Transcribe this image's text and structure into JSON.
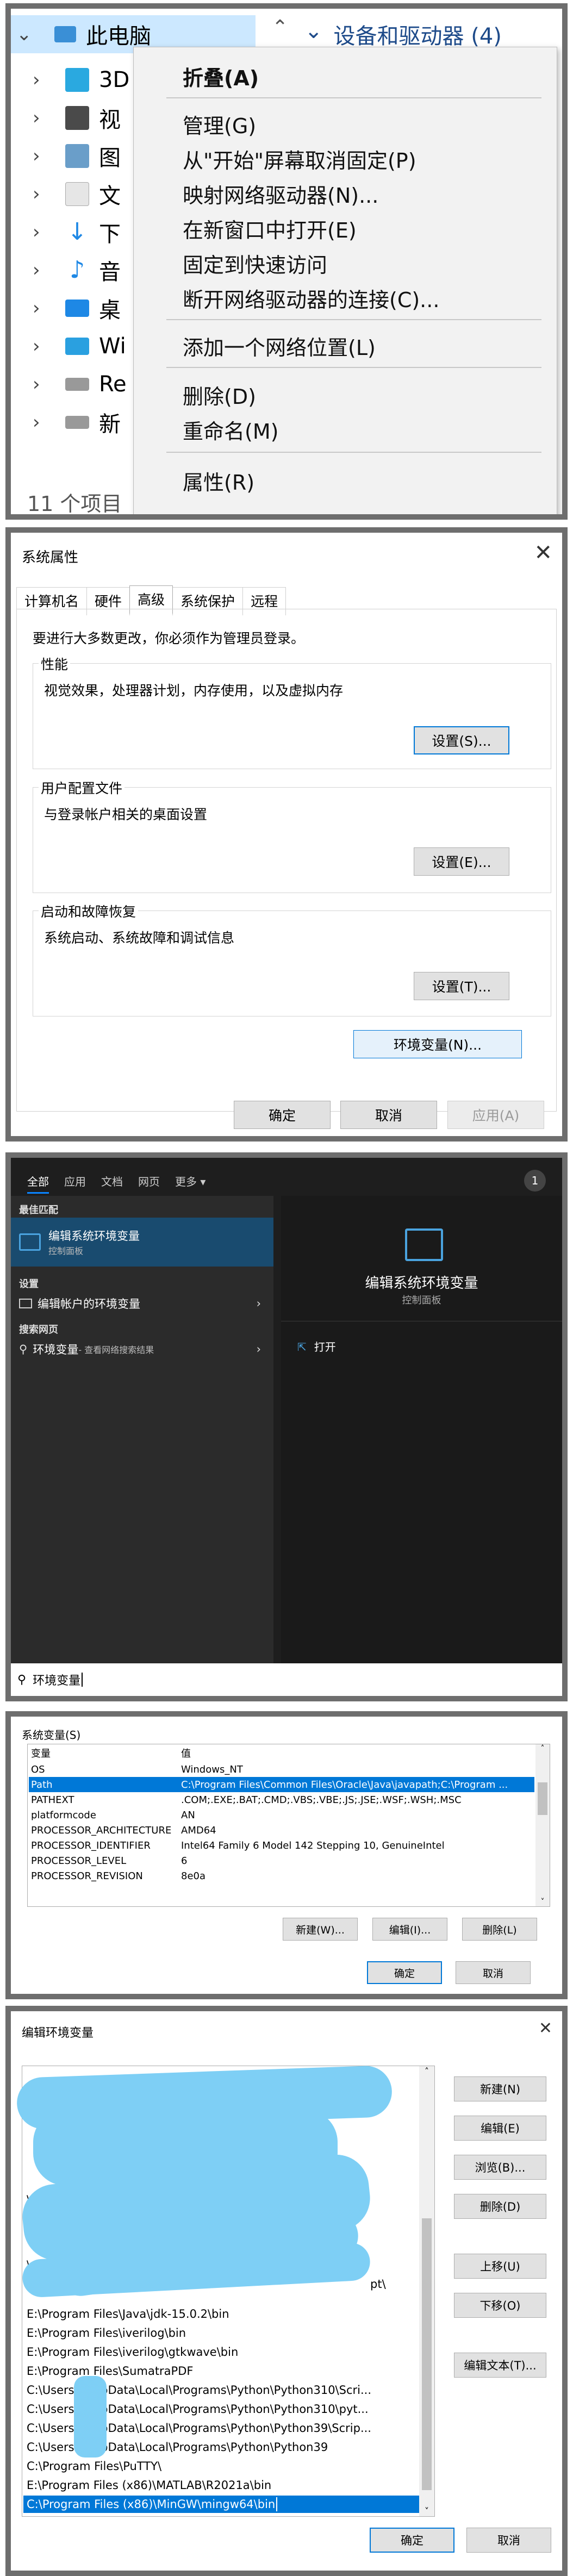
{
  "explorer": {
    "tree": [
      {
        "label": "此电脑",
        "expanded": true,
        "color": "#3a8fd6"
      },
      {
        "label": "3D",
        "color": "#2aa9e0"
      },
      {
        "label": "视",
        "color": "#4a4a4a"
      },
      {
        "label": "图",
        "color": "#6a9ec9"
      },
      {
        "label": "文",
        "color": "#cfcfcf"
      },
      {
        "label": "下",
        "color": "#1e88e5"
      },
      {
        "label": "音",
        "color": "#1e88e5"
      },
      {
        "label": "桌",
        "color": "#1e88e5"
      },
      {
        "label": "Wi",
        "color": "#2aa0e0"
      },
      {
        "label": "Re",
        "color": "#888888"
      },
      {
        "label": "新",
        "color": "#888888"
      }
    ],
    "footer": "11 个项目",
    "right_header": "设备和驱动器 (4)"
  },
  "context_menu": {
    "items": [
      "折叠(A)",
      "管理(G)",
      "从\"开始\"屏幕取消固定(P)",
      "映射网络驱动器(N)...",
      "在新窗口中打开(E)",
      "固定到快速访问",
      "断开网络驱动器的连接(C)...",
      "添加一个网络位置(L)",
      "删除(D)",
      "重命名(M)",
      "属性(R)"
    ]
  },
  "sys_props": {
    "title": "系统属性",
    "close": "✕",
    "tabs": [
      "计算机名",
      "硬件",
      "高级",
      "系统保护",
      "远程"
    ],
    "admin_note": "要进行大多数更改，你必须作为管理员登录。",
    "groups": [
      {
        "label": "性能",
        "desc": "视觉效果，处理器计划，内存使用，以及虚拟内存",
        "button": "设置(S)..."
      },
      {
        "label": "用户配置文件",
        "desc": "与登录帐户相关的桌面设置",
        "button": "设置(E)..."
      },
      {
        "label": "启动和故障恢复",
        "desc": "系统启动、系统故障和调试信息",
        "button": "设置(T)..."
      }
    ],
    "env_button": "环境变量(N)...",
    "ok": "确定",
    "cancel": "取消",
    "apply": "应用(A)"
  },
  "search": {
    "tabs": [
      "全部",
      "应用",
      "文档",
      "网页",
      "更多 ▾"
    ],
    "badge": "1",
    "best_match_heading": "最佳匹配",
    "best_title": "编辑系统环境变量",
    "best_sub": "控制面板",
    "settings_heading": "设置",
    "settings_item": "编辑帐户的环境变量",
    "web_heading": "搜索网页",
    "web_item": "环境变量",
    "web_item_sub": " - 查看网络搜索结果",
    "preview_title": "编辑系统环境变量",
    "preview_type": "控制面板",
    "open": "打开",
    "query": "环境变量"
  },
  "sys_vars": {
    "title": "系统变量(S)",
    "col_var": "变量",
    "col_val": "值",
    "rows": [
      {
        "k": "OS",
        "v": "Windows_NT"
      },
      {
        "k": "Path",
        "v": "C:\\Program Files\\Common Files\\Oracle\\Java\\javapath;C:\\Program ..."
      },
      {
        "k": "PATHEXT",
        "v": ".COM;.EXE;.BAT;.CMD;.VBS;.VBE;.JS;.JSE;.WSF;.WSH;.MSC"
      },
      {
        "k": "platformcode",
        "v": "AN"
      },
      {
        "k": "PROCESSOR_ARCHITECTURE",
        "v": "AMD64"
      },
      {
        "k": "PROCESSOR_IDENTIFIER",
        "v": "Intel64 Family 6 Model 142 Stepping 10, GenuineIntel"
      },
      {
        "k": "PROCESSOR_LEVEL",
        "v": "6"
      },
      {
        "k": "PROCESSOR_REVISION",
        "v": "8e0a"
      }
    ],
    "new": "新建(W)...",
    "edit": "编辑(I)...",
    "delete": "删除(L)",
    "ok": "确定",
    "cancel": "取消"
  },
  "edit_env": {
    "title": "编辑环境变量",
    "close": "✕",
    "rows": [
      "\\",
      "\\",
      "\\",
      "pt\\",
      "E:\\Program Files\\Java\\jdk-15.0.2\\bin",
      "E:\\Program Files\\iverilog\\bin",
      "E:\\Program Files\\iverilog\\gtkwave\\bin",
      "E:\\Program Files\\SumatraPDF",
      "C:\\Users\\      \\AppData\\Local\\Programs\\Python\\Python310\\Scri...",
      "C:\\Users\\      \\AppData\\Local\\Programs\\Python\\Python310\\pyt...",
      "C:\\Users\\      \\AppData\\Local\\Programs\\Python\\Python39\\Scrip...",
      "C:\\Users\\      \\AppData\\Local\\Programs\\Python\\Python39",
      "C:\\Program Files\\PuTTY\\",
      "E:\\Program Files (x86)\\MATLAB\\R2021a\\bin",
      "C:\\Program Files (x86)\\MinGW\\mingw64\\bin"
    ],
    "buttons": [
      "新建(N)",
      "编辑(E)",
      "浏览(B)...",
      "删除(D)",
      "上移(U)",
      "下移(O)",
      "编辑文本(T)..."
    ],
    "ok": "确定",
    "cancel": "取消",
    "redaction_color": "#7ecff5"
  }
}
